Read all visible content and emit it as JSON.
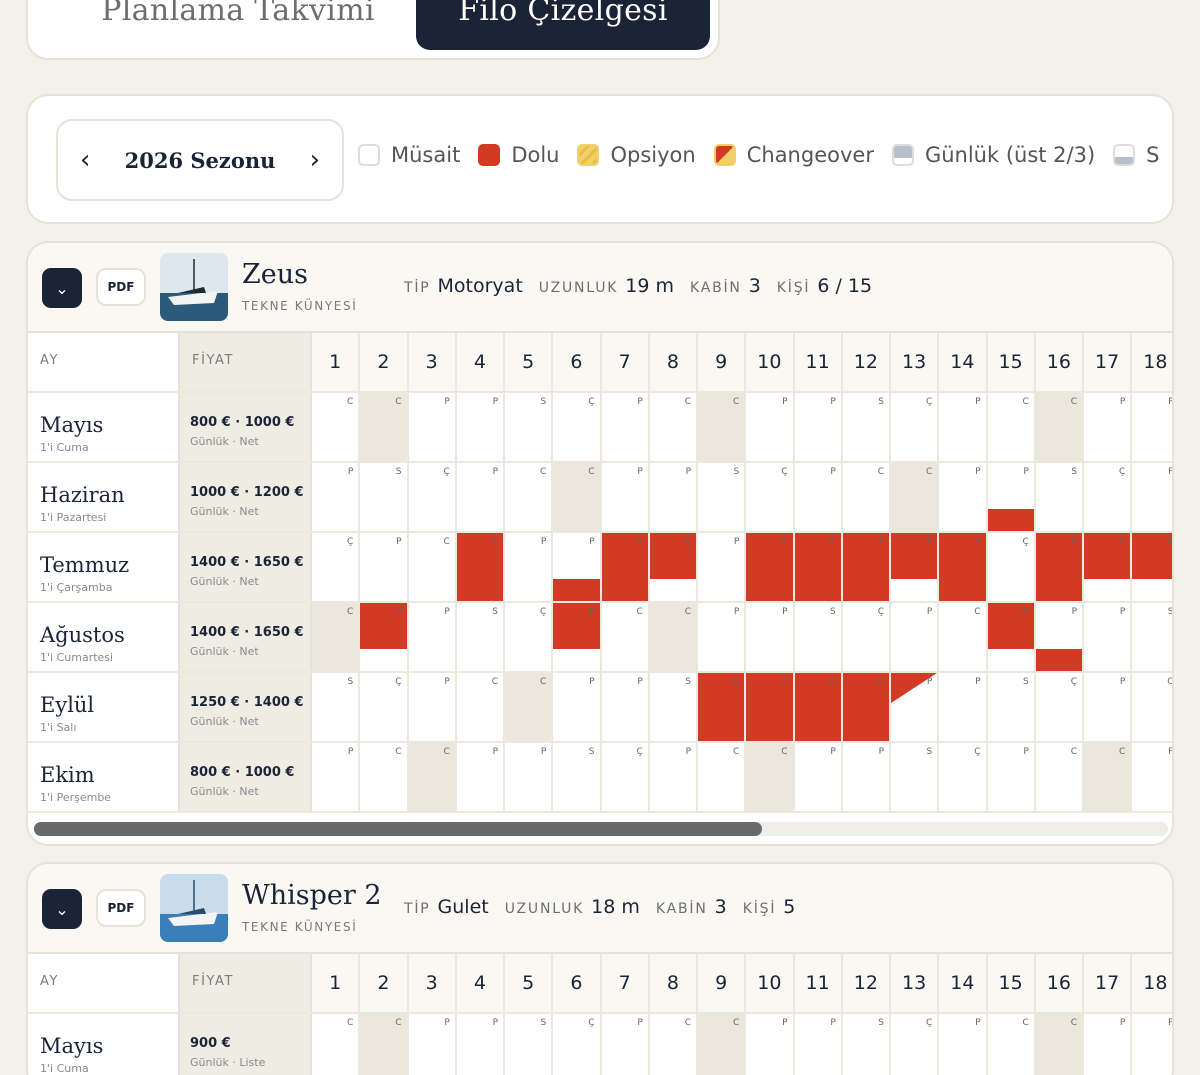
{
  "tabs": {
    "planning": "Planlama Takvimi",
    "fleet": "Filo Çizelgesi"
  },
  "season": {
    "label": "2026 Sezonu",
    "prev": "‹",
    "next": "›"
  },
  "legend": [
    {
      "label": "Müsait",
      "swatch": "musait"
    },
    {
      "label": "Dolu",
      "swatch": "dolu"
    },
    {
      "label": "Opsiyon",
      "swatch": "ops"
    },
    {
      "label": "Changeover",
      "swatch": "chg"
    },
    {
      "label": "Günlük (üst 2/3)",
      "swatch": "gun"
    },
    {
      "label": "S",
      "swatch": "s"
    }
  ],
  "colors": {
    "booked": "#d23a24",
    "navy": "#1b2336",
    "option": "#f1cf6a"
  },
  "boats": [
    {
      "name": "Zeus",
      "subtitle": "TEKNE KÜNYESİ",
      "pdf": "PDF",
      "specs": {
        "tip_k": "TİP",
        "tip_v": "Motoryat",
        "uz_k": "UZUNLUK",
        "uz_v": "19 m",
        "kab_k": "KABİN",
        "kab_v": "3",
        "kisi_k": "KİŞİ",
        "kisi_v": "6 / 15"
      },
      "col_ay": "AY",
      "col_fiyat": "FİYAT",
      "days": [
        "1",
        "2",
        "3",
        "4",
        "5",
        "6",
        "7",
        "8",
        "9",
        "10",
        "11",
        "12",
        "13",
        "14",
        "15",
        "16",
        "17",
        "18"
      ],
      "months": [
        {
          "name": "Mayıs",
          "start": "1'i Cuma",
          "price": "800 € · 1000 €",
          "note": "Günlük · Net",
          "letters": [
            "C",
            "C",
            "P",
            "P",
            "S",
            "Ç",
            "P",
            "C",
            "C",
            "P",
            "P",
            "S",
            "Ç",
            "P",
            "C",
            "C",
            "P",
            "P"
          ]
        },
        {
          "name": "Haziran",
          "start": "1'i Pazartesi",
          "price": "1000 € · 1200 €",
          "note": "Günlük · Net",
          "letters": [
            "P",
            "S",
            "Ç",
            "P",
            "C",
            "C",
            "P",
            "P",
            "S",
            "Ç",
            "P",
            "C",
            "C",
            "P",
            "P",
            "S",
            "Ç",
            "P"
          ]
        },
        {
          "name": "Temmuz",
          "start": "1'i Çarşamba",
          "price": "1400 € · 1650 €",
          "note": "Günlük · Net",
          "letters": [
            "Ç",
            "P",
            "C",
            "C",
            "P",
            "P",
            "S",
            "Ç",
            "P",
            "C",
            "C",
            "P",
            "P",
            "S",
            "Ç",
            "P",
            "C",
            "C"
          ]
        },
        {
          "name": "Ağustos",
          "start": "1'i Cumartesi",
          "price": "1400 € · 1650 €",
          "note": "Günlük · Net",
          "letters": [
            "C",
            "P",
            "P",
            "S",
            "Ç",
            "P",
            "C",
            "C",
            "P",
            "P",
            "S",
            "Ç",
            "P",
            "C",
            "C",
            "P",
            "P",
            "S"
          ]
        },
        {
          "name": "Eylül",
          "start": "1'i Salı",
          "price": "1250 € · 1400 €",
          "note": "Günlük · Net",
          "letters": [
            "S",
            "Ç",
            "P",
            "C",
            "C",
            "P",
            "P",
            "S",
            "Ç",
            "P",
            "C",
            "C",
            "P",
            "P",
            "S",
            "Ç",
            "P",
            "C"
          ]
        },
        {
          "name": "Ekim",
          "start": "1'i Perşembe",
          "price": "800 € · 1000 €",
          "note": "Günlük · Net",
          "letters": [
            "P",
            "C",
            "C",
            "P",
            "P",
            "S",
            "Ç",
            "P",
            "C",
            "C",
            "P",
            "P",
            "S",
            "Ç",
            "P",
            "C",
            "C",
            "P"
          ]
        }
      ]
    },
    {
      "name": "Whisper 2",
      "subtitle": "TEKNE KÜNYESİ",
      "pdf": "PDF",
      "specs": {
        "tip_k": "TİP",
        "tip_v": "Gulet",
        "uz_k": "UZUNLUK",
        "uz_v": "18 m",
        "kab_k": "KABİN",
        "kab_v": "3",
        "kisi_k": "KİŞİ",
        "kisi_v": "5"
      },
      "col_ay": "AY",
      "col_fiyat": "FİYAT",
      "days": [
        "1",
        "2",
        "3",
        "4",
        "5",
        "6",
        "7",
        "8",
        "9",
        "10",
        "11",
        "12",
        "13",
        "14",
        "15",
        "16",
        "17",
        "18"
      ],
      "months": [
        {
          "name": "Mayıs",
          "start": "1'i Cuma",
          "price": "900 €",
          "note": "Günlük · Liste",
          "letters": [
            "C",
            "C",
            "P",
            "P",
            "S",
            "Ç",
            "P",
            "C",
            "C",
            "P",
            "P",
            "S",
            "Ç",
            "P",
            "C",
            "C",
            "P",
            "P"
          ]
        }
      ]
    }
  ]
}
